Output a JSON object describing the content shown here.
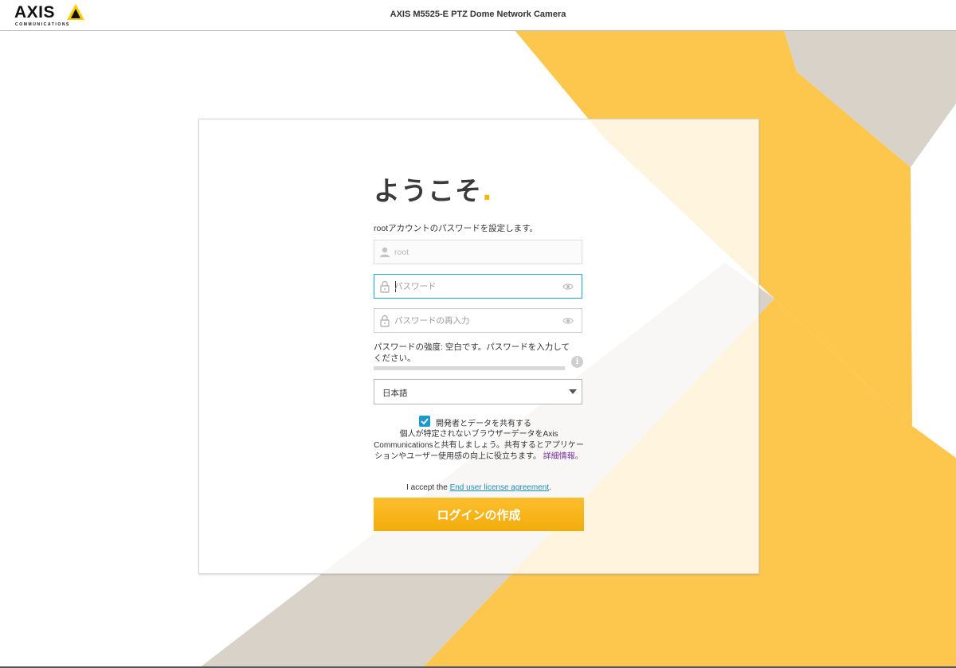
{
  "header": {
    "brand": "AXIS",
    "brand_sub": "COMMUNICATIONS",
    "title": "AXIS M5525-E PTZ Dome Network Camera"
  },
  "login": {
    "welcome": "ようこそ",
    "welcome_dot": ".",
    "instruction": "rootアカウントのパスワードを設定します。",
    "username_placeholder": "root",
    "password_placeholder": "パスワード",
    "password_confirm_placeholder": "パスワードの再入力",
    "strength_text": "パスワードの強度: 空白です。パスワードを入力してください。",
    "strength_level": 0,
    "language": "日本語",
    "share_label": "開発者とデータを共有する",
    "share_checked": true,
    "share_description": "個人が特定されないブラウザーデータをAxis Communicationsと共有しましょう。共有するとアプリケーションやユーザー使用感の向上に役立ちます。",
    "share_more": "詳細情報。",
    "eula_prefix": "I accept the ",
    "eula_link": "End user license agreement",
    "eula_suffix": ".",
    "create_button": "ログインの作成"
  },
  "colors": {
    "accent_yellow": "#FFCC33",
    "stripe_beige": "#D8D2C9",
    "focus_blue": "#1CA6D9",
    "link_purple": "#7A2E9E"
  },
  "icons": {
    "user": "user-icon",
    "lock": "lock-icon",
    "eye": "eye-icon",
    "info": "info-icon",
    "check": "check-icon",
    "dropdown": "chevron-down-icon"
  }
}
